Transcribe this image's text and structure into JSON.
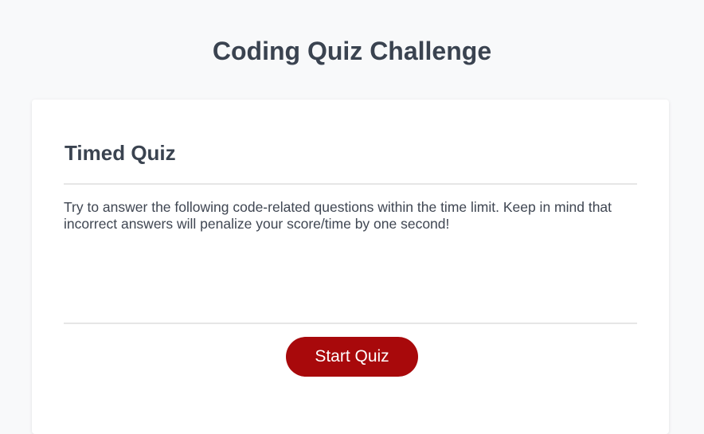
{
  "header": {
    "title": "Coding Quiz Challenge"
  },
  "card": {
    "title": "Timed Quiz",
    "description": "Try to answer the following code-related questions within the time limit. Keep in mind that incorrect answers will penalize your score/time by one second!",
    "start_button_label": "Start Quiz"
  },
  "colors": {
    "accent": "#a8090b",
    "background": "#f8f9fa",
    "text": "#3a4350"
  }
}
